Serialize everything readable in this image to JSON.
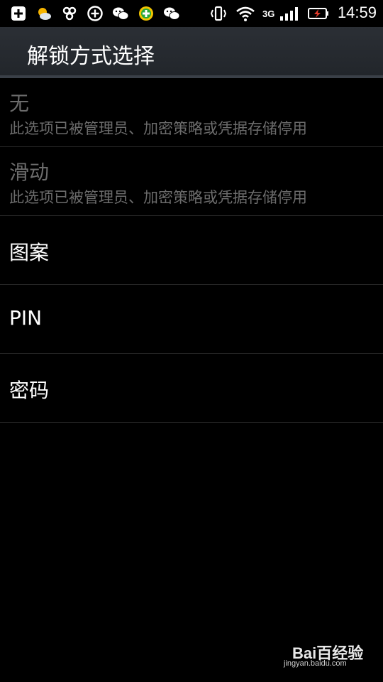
{
  "status_bar": {
    "time": "14:59",
    "network": "3G",
    "icons": [
      "add-icon",
      "weather-icon",
      "app-icon",
      "plus-circle-icon",
      "wechat-icon",
      "green-app-icon",
      "wechat-icon",
      "vibrate-icon",
      "wifi-icon",
      "signal-icon",
      "battery-charging-icon"
    ]
  },
  "action_bar": {
    "title": "解锁方式选择"
  },
  "options": [
    {
      "title": "无",
      "subtitle": "此选项已被管理员、加密策略或凭据存储停用",
      "enabled": false
    },
    {
      "title": "滑动",
      "subtitle": "此选项已被管理员、加密策略或凭据存储停用",
      "enabled": false
    },
    {
      "title": "图案",
      "enabled": true
    },
    {
      "title": "PIN",
      "enabled": true
    },
    {
      "title": "密码",
      "enabled": true
    }
  ],
  "watermark": {
    "logo": "Bai百经验",
    "url": "jingyan.baidu.com"
  },
  "colors": {
    "background": "#000000",
    "action_bar": "#2b2f35",
    "disabled_text": "#6c6c6c",
    "divider": "#262626"
  }
}
